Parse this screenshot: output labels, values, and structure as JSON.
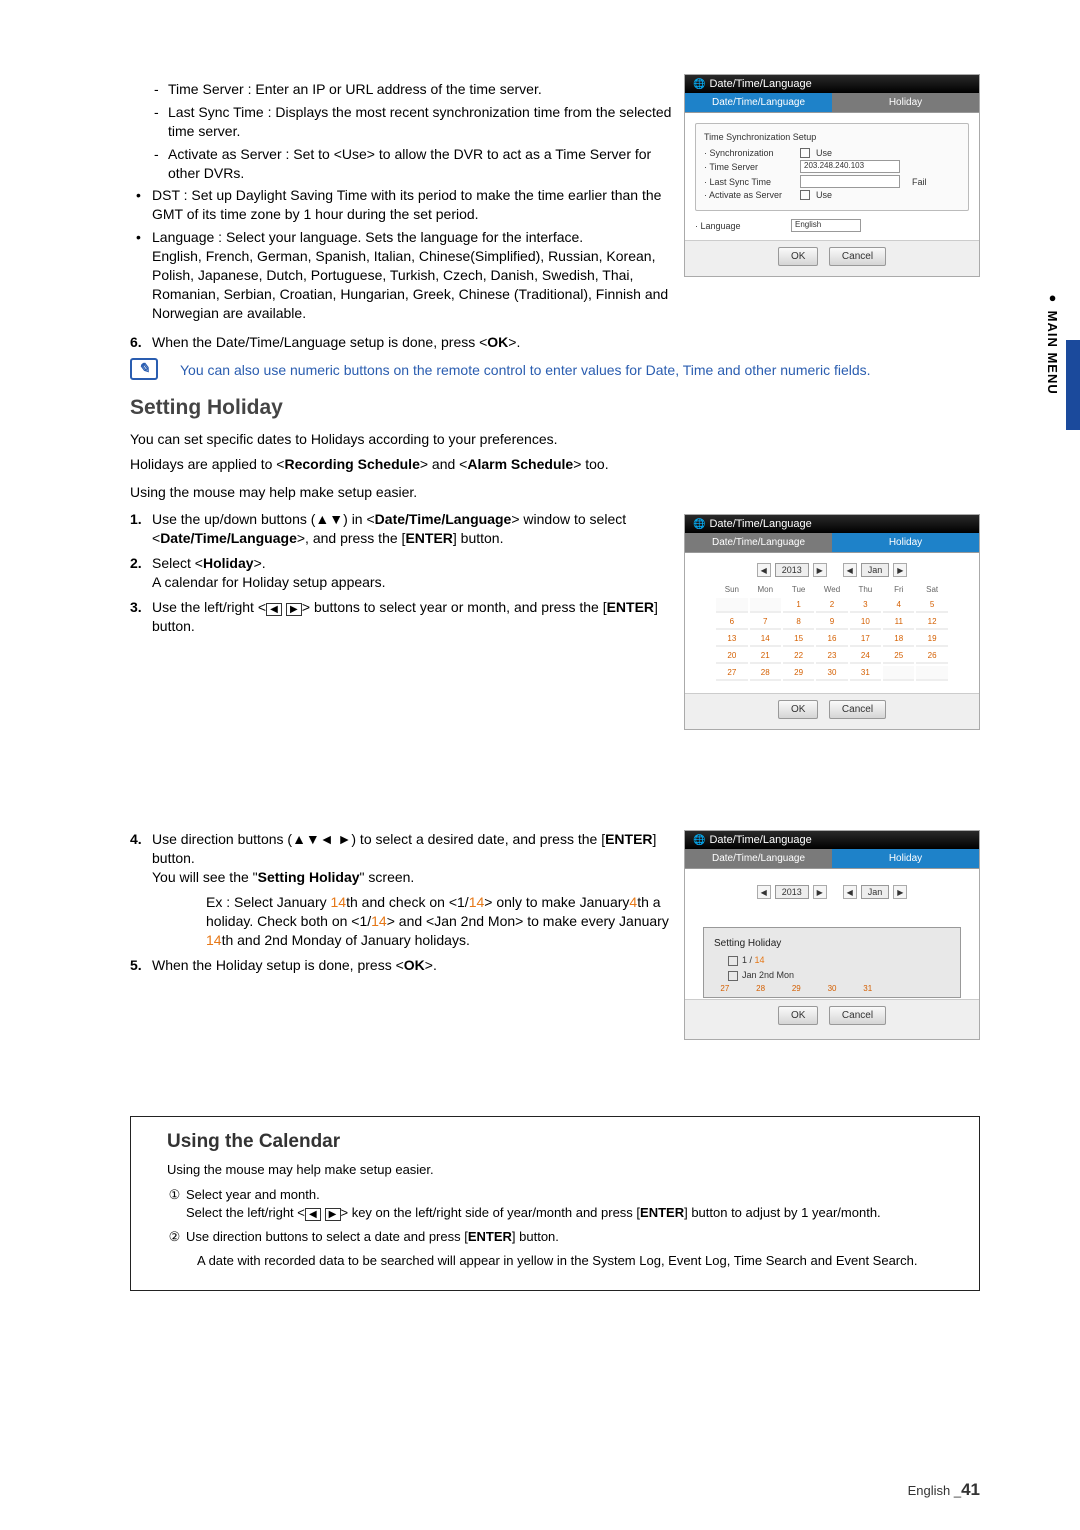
{
  "side_label": "● MAIN MENU",
  "top_list": {
    "sub_items": [
      "Time Server : Enter an IP or URL address of the time server.",
      "Last Sync Time : Displays the most recent synchronization time from the selected time server.",
      "Activate as Server : Set to <Use> to allow the DVR to act as a Time Server for other DVRs."
    ],
    "dst": "DST : Set up Daylight Saving Time with its period to make the time earlier than the GMT of its time zone by 1 hour during the set period.",
    "language": "Language : Select your language. Sets the language for the interface.",
    "language_detail": "English, French, German, Spanish, Italian, Chinese(Simplified), Russian, Korean, Polish, Japanese, Dutch, Portuguese, Turkish, Czech, Danish, Swedish, Thai, Romanian, Serbian, Croatian, Hungarian, Greek, Chinese (Traditional), Finnish and Norwegian are available."
  },
  "step6": {
    "num": "6.",
    "pre": "When the Date/Time/Language setup is done, press <",
    "key": "OK",
    "post": ">."
  },
  "note": "You can also use numeric buttons on the remote control to enter values for Date, Time and other numeric fields.",
  "holiday_title": "Setting Holiday",
  "holiday_intro_line1_a": "You can set specific dates to Holidays according to your preferences.",
  "holiday_intro_line1_b_pre": "Holidays are applied to <",
  "holiday_intro_line1_b_b1": "Recording Schedule",
  "holiday_intro_line1_b_mid": "> and <",
  "holiday_intro_line1_b_b2": "Alarm Schedule",
  "holiday_intro_line1_b_post": "> too.",
  "holiday_mouse": "Using the mouse may help make setup easier.",
  "h_steps": {
    "s1": {
      "num": "1.",
      "pre": "Use the up/down buttons (▲▼) in <",
      "b1": "Date/Time/Language",
      "mid": "> window to select <",
      "b2": "Date/Time/Language",
      "post": ">, and press the [",
      "b3": "ENTER",
      "post2": "] button."
    },
    "s2": {
      "num": "2.",
      "pre": "Select <",
      "b": "Holiday",
      "post": ">.",
      "line2": "A calendar for Holiday setup appears."
    },
    "s3": {
      "num": "3.",
      "pre": "Use the left/right <",
      "post": "> buttons to select year or month, and press the [",
      "b": "ENTER",
      "post2": "] button."
    },
    "s4": {
      "num": "4.",
      "pre": "Use direction buttons (▲▼◄ ►) to select a desired date, and press the [",
      "b": "ENTER",
      "mid": "] button.",
      "line2_a": "You will see the \"",
      "line2_b": "Setting Holiday",
      "line2_c": "\" screen.",
      "ex_pre": "Ex : Select January ",
      "ex_14": "14",
      "ex_a": "th and check on <1/",
      "ex_b": "> only to make January",
      "ex_4": "4",
      "ex_c": "th a holiday. Check both on <1/",
      "ex_d": "> and <Jan 2nd Mon> to make every January ",
      "ex_e": "th and 2nd Monday of January holidays."
    },
    "s5": {
      "num": "5.",
      "pre": "When the Holiday setup is done, press <",
      "b": "OK",
      "post": ">."
    }
  },
  "infobox": {
    "title": "Using the Calendar",
    "mouse": "Using the mouse may help make setup easier.",
    "i1_a": "Select year and month.",
    "i1_b_pre": "Select the left/right <",
    "i1_b_mid": "> key on the left/right side of year/month and press [",
    "i1_b_b": "ENTER",
    "i1_b_post": "] button to adjust by 1 year/month.",
    "i2_pre": "Use direction buttons to select a date and press [",
    "i2_b": "ENTER",
    "i2_post": "] button.",
    "note": "A date with recorded data to be searched will appear in yellow in the System Log, Event Log, Time Search and Event Search."
  },
  "panel1": {
    "title": "Date/Time/Language",
    "tab1": "Date/Time/Language",
    "tab2": "Holiday",
    "frame_title": "Time Synchronization Setup",
    "r1": "· Synchronization",
    "r1v": "Use",
    "r2": "· Time Server",
    "r2v": "203.248.240.103",
    "r3": "· Last Sync Time",
    "r3s": "Fail",
    "r4": "· Activate as Server",
    "r4v": "Use",
    "lang_lbl": "· Language",
    "lang_val": "English",
    "ok": "OK",
    "cancel": "Cancel"
  },
  "panel2": {
    "title": "Date/Time/Language",
    "tab1": "Date/Time/Language",
    "tab2": "Holiday",
    "year": "2013",
    "month": "Jan",
    "dow": [
      "Sun",
      "Mon",
      "Tue",
      "Wed",
      "Thu",
      "Fri",
      "Sat"
    ],
    "weeks": [
      [
        "",
        "",
        "1",
        "2",
        "3",
        "4",
        "5"
      ],
      [
        "6",
        "7",
        "8",
        "9",
        "10",
        "11",
        "12"
      ],
      [
        "13",
        "14",
        "15",
        "16",
        "17",
        "18",
        "19"
      ],
      [
        "20",
        "21",
        "22",
        "23",
        "24",
        "25",
        "26"
      ],
      [
        "27",
        "28",
        "29",
        "30",
        "31",
        "",
        ""
      ]
    ],
    "ok": "OK",
    "cancel": "Cancel"
  },
  "panel3": {
    "title": "Date/Time/Language",
    "tab1": "Date/Time/Language",
    "tab2": "Holiday",
    "year": "2013",
    "month": "Jan",
    "overlay_title": "Setting Holiday",
    "opt1_a": "1 / ",
    "opt1_b": "14",
    "opt2": "Jan 2nd Mon",
    "bottom_row": [
      "27",
      "28",
      "29",
      "30",
      "31"
    ],
    "ok": "OK",
    "cancel": "Cancel"
  },
  "footer": {
    "lang": "English _",
    "page": "41"
  }
}
